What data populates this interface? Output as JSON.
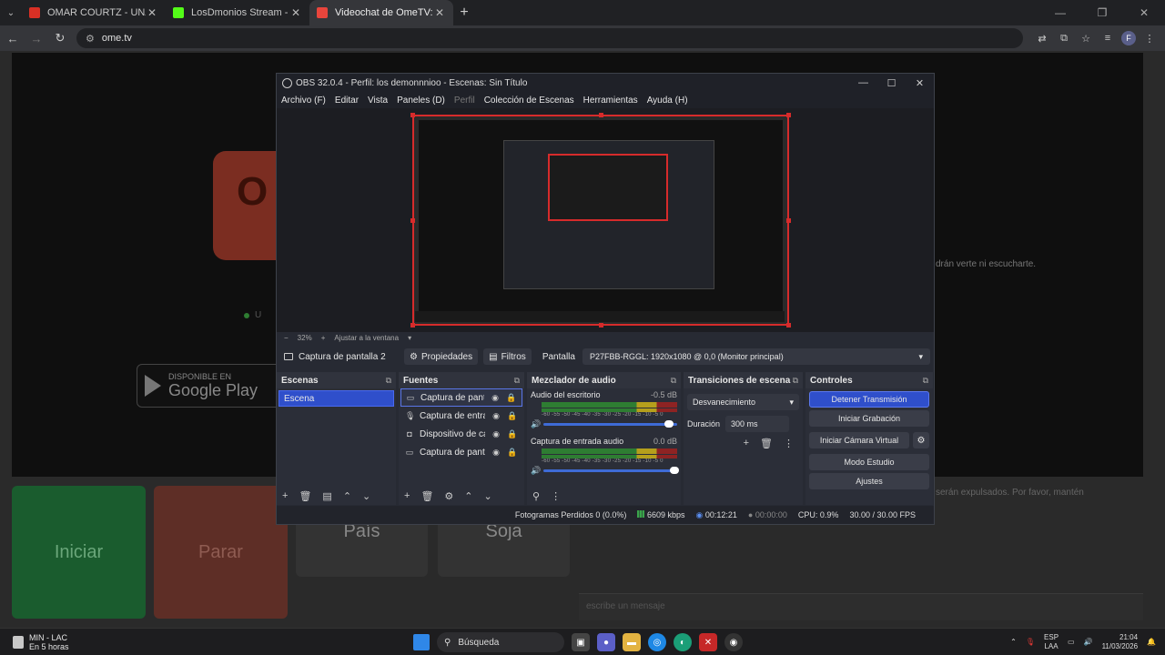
{
  "browser": {
    "tabs": [
      {
        "label": "OMAR COURTZ - UNA NOTI (V",
        "color": "#d93025",
        "active": false
      },
      {
        "label": "LosDmonios Stream - Kick Dash",
        "color": "#53fc18",
        "active": false
      },
      {
        "label": "Videochat de OmeTV: una alte",
        "color": "#e8453c",
        "active": true
      }
    ],
    "url": "ome.tv",
    "profile_initial": "F"
  },
  "page": {
    "logo_text": "O",
    "play_badge_line1": "DISPONIBLE EN",
    "play_badge_line2": "Google Play",
    "hint_text": "drán verte ni escucharte.",
    "notice_text": "serán expulsados. Por favor, mantén",
    "online_text": "U",
    "buttons": {
      "start": "Iniciar",
      "stop": "Parar",
      "country": "País",
      "gender": "Soja"
    },
    "chat_placeholder": "escribe un mensaje"
  },
  "obs": {
    "title": "OBS 32.0.4 - Perfil: los demonnnioo - Escenas: Sin Título",
    "menu": [
      {
        "label": "Archivo (F)",
        "dim": false
      },
      {
        "label": "Editar",
        "dim": false
      },
      {
        "label": "Vista",
        "dim": false
      },
      {
        "label": "Paneles (D)",
        "dim": false
      },
      {
        "label": "Perfil",
        "dim": true
      },
      {
        "label": "Colección de Escenas",
        "dim": false
      },
      {
        "label": "Herramientas",
        "dim": false
      },
      {
        "label": "Ayuda (H)",
        "dim": false
      }
    ],
    "zoom": {
      "minus": "−",
      "value": "32%",
      "plus": "+",
      "fit": "Ajustar a la ventana"
    },
    "source_bar": {
      "name": "Captura de pantalla 2",
      "properties": "Propiedades",
      "filters": "Filtros",
      "screen_label": "Pantalla",
      "screen_value": "P27FBB-RGGL: 1920x1080 @ 0,0 (Monitor principal)"
    },
    "scenes": {
      "title": "Escenas",
      "items": [
        "Escena"
      ]
    },
    "sources": {
      "title": "Fuentes",
      "items": [
        {
          "label": "Captura de pantalla",
          "icon": "monitor-icon"
        },
        {
          "label": "Captura de entrada",
          "icon": "microphone-icon"
        },
        {
          "label": "Dispositivo de captu",
          "icon": "camera-icon"
        },
        {
          "label": "Captura de pantalla",
          "icon": "monitor-icon"
        }
      ]
    },
    "mixer": {
      "title": "Mezclador de audio",
      "tracks": [
        {
          "name": "Audio del escritorio",
          "db": "-0.5 dB",
          "level": 0.96
        },
        {
          "name": "Captura de entrada audio",
          "db": "0.0 dB",
          "level": 1.0
        }
      ],
      "scale": "-60 -55 -50 -45 -40 -35 -30 -25 -20 -15 -10 -5 0"
    },
    "transitions": {
      "title": "Transiciones de escena",
      "type": "Desvanecimiento",
      "duration_label": "Duración",
      "duration_value": "300 ms"
    },
    "controls": {
      "title": "Controles",
      "stop_stream": "Detener Transmisión",
      "start_recording": "Iniciar Grabación",
      "start_virtual_cam": "Iniciar Cámara Virtual",
      "studio_mode": "Modo Estudio",
      "settings": "Ajustes"
    },
    "status": {
      "dropped_frames": "Fotogramas Perdidos 0 (0.0%)",
      "bitrate": "6609 kbps",
      "stream_time": "00:12:21",
      "rec_time": "00:00:00",
      "cpu": "CPU: 0.9%",
      "fps": "30.00 / 30.00 FPS"
    }
  },
  "taskbar": {
    "weather_line1": "MIN - LAC",
    "weather_line2": "En 5 horas",
    "search": "Búsqueda",
    "lang_line1": "ESP",
    "lang_line2": "LAA",
    "time": "21:04",
    "date": "11/03/2026"
  },
  "colors": {
    "accent": "#2f4fcb",
    "recording_red": "#d62b2b"
  }
}
